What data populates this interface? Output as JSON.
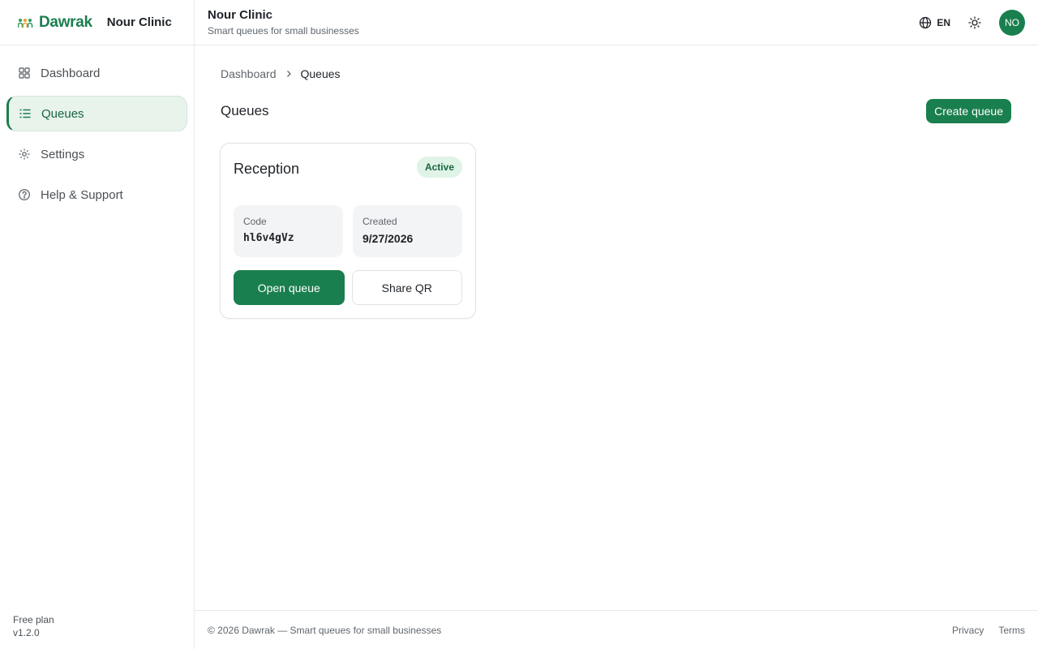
{
  "brand": {
    "logo_text": "Dawrak",
    "org_name": "Nour Clinic"
  },
  "sidebar": {
    "items": [
      {
        "label": "Dashboard",
        "icon": "dashboard-icon"
      },
      {
        "label": "Queues",
        "icon": "list-icon",
        "active": true
      },
      {
        "label": "Settings",
        "icon": "gear-icon"
      },
      {
        "label": "Help & Support",
        "icon": "help-icon"
      }
    ],
    "plan": "Free plan",
    "version": "v1.2.0"
  },
  "header": {
    "title": "Nour Clinic",
    "subtitle": "Smart queues for small businesses",
    "language": "EN",
    "avatar_initials": "NO"
  },
  "breadcrumb": {
    "parent": "Dashboard",
    "current": "Queues"
  },
  "page": {
    "title": "Queues",
    "create_button": "Create queue"
  },
  "queues": [
    {
      "name": "Reception",
      "status": "Active",
      "code_label": "Code",
      "code": "hl6v4gVz",
      "created_label": "Created",
      "created": "9/27/2026",
      "open_button": "Open queue",
      "share_button": "Share QR"
    }
  ],
  "footer": {
    "copyright": "© 2026 Dawrak — Smart queues for small businesses",
    "links": [
      "Privacy",
      "Terms"
    ]
  },
  "colors": {
    "primary": "#1a7f4e",
    "active_bg": "#e8f3ec",
    "badge_bg": "#dff3e6"
  }
}
